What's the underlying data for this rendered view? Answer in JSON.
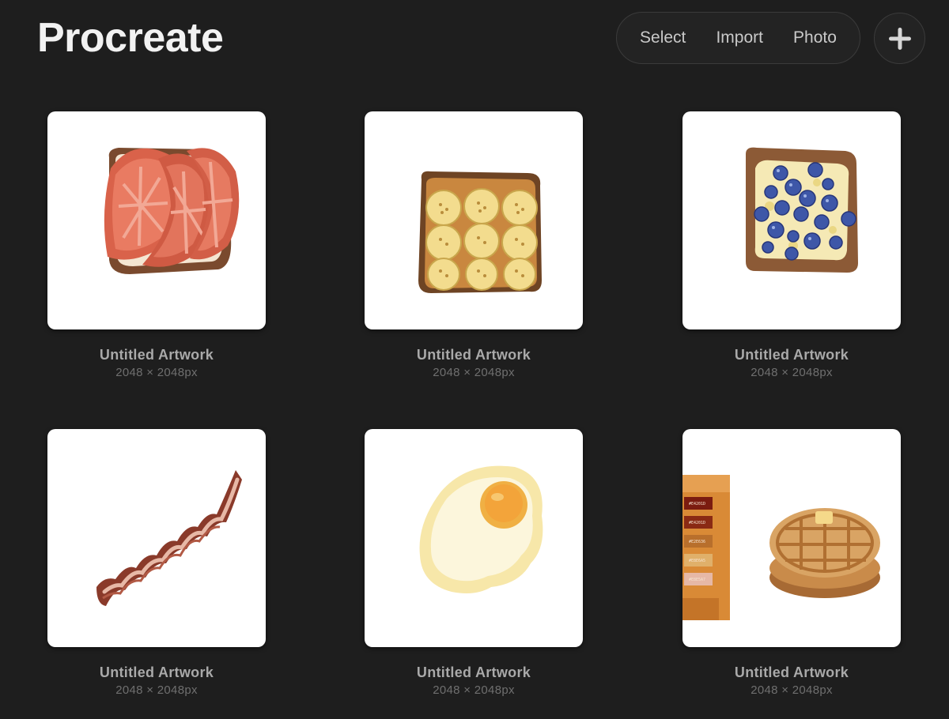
{
  "app": {
    "title": "Procreate"
  },
  "toolbar": {
    "select_label": "Select",
    "import_label": "Import",
    "photo_label": "Photo",
    "add_icon": "plus-icon"
  },
  "gallery": {
    "items": [
      {
        "name": "Untitled Artwork",
        "size": "2048 × 2048px",
        "artwork": "tomato-toast"
      },
      {
        "name": "Untitled Artwork",
        "size": "2048 × 2048px",
        "artwork": "banana-toast"
      },
      {
        "name": "Untitled Artwork",
        "size": "2048 × 2048px",
        "artwork": "blueberry-toast"
      },
      {
        "name": "Untitled Artwork",
        "size": "2048 × 2048px",
        "artwork": "bacon-strip"
      },
      {
        "name": "Untitled Artwork",
        "size": "2048 × 2048px",
        "artwork": "fried-egg"
      },
      {
        "name": "Untitled Artwork",
        "size": "2048 × 2048px",
        "artwork": "waffles-with-palette",
        "swatches": [
          "#E4201D",
          "#E4201D",
          "#E2E636",
          "#E8E6A5",
          "#E8E5A7"
        ]
      }
    ]
  },
  "colors": {
    "background": "#1e1e1e",
    "card_background": "#ffffff",
    "title_text": "#f2f2f2",
    "label_text": "#a9a9a9",
    "sublabel_text": "#6f6f6f"
  }
}
